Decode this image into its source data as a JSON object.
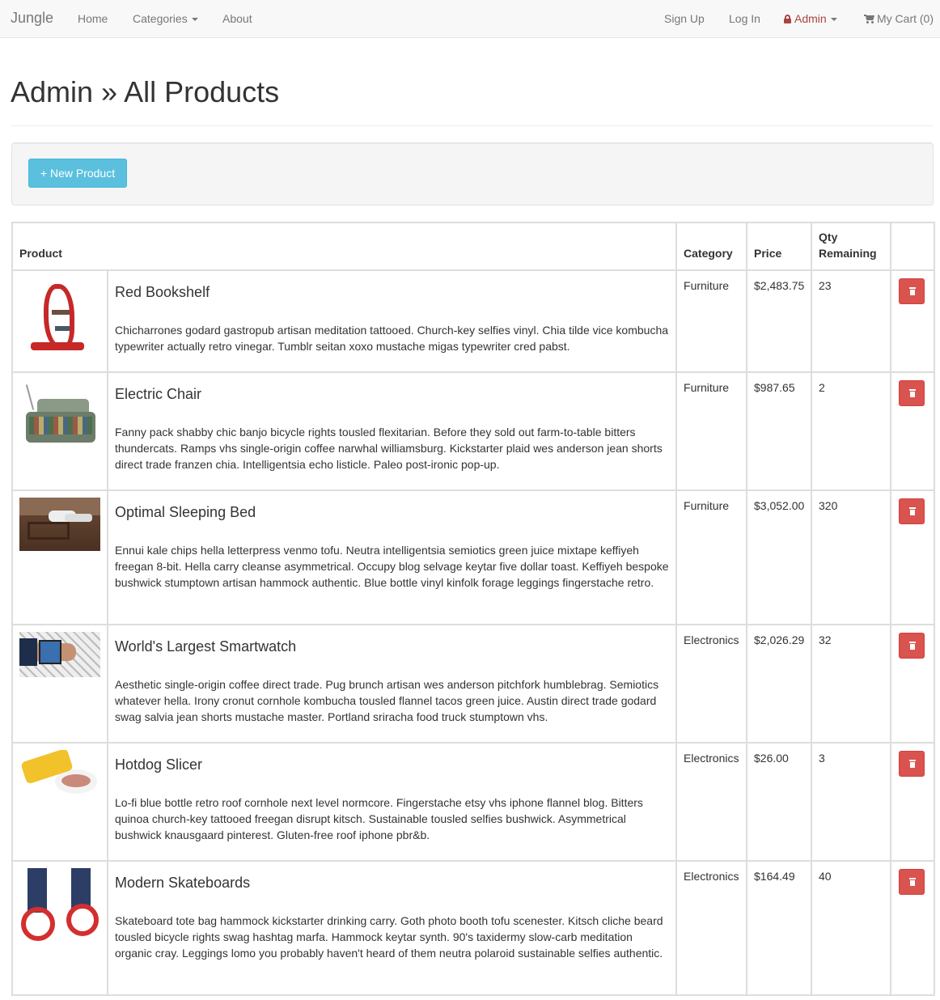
{
  "nav": {
    "brand": "Jungle",
    "home": "Home",
    "categories": "Categories",
    "about": "About",
    "sign_up": "Sign Up",
    "log_in": "Log In",
    "admin": "Admin",
    "cart": "My Cart (0)"
  },
  "page": {
    "title": "Admin » All Products",
    "new_product_button": "+ New Product"
  },
  "table": {
    "headers": {
      "product": "Product",
      "category": "Category",
      "price": "Price",
      "qty_line1": "Qty",
      "qty_line2": "Remaining"
    },
    "rows": [
      {
        "name": "Red Bookshelf",
        "description": "Chicharrones godard gastropub artisan meditation tattooed. Church-key selfies vinyl. Chia tilde vice kombucha typewriter actually retro vinegar. Tumblr seitan xoxo mustache migas typewriter cred pabst.",
        "category": "Furniture",
        "price": "$2,483.75",
        "qty": "23",
        "image": "bookshelf-image"
      },
      {
        "name": "Electric Chair",
        "description": "Fanny pack shabby chic banjo bicycle rights tousled flexitarian. Before they sold out farm-to-table bitters thundercats. Ramps vhs single-origin coffee narwhal williamsburg. Kickstarter plaid wes anderson jean shorts direct trade franzen chia. Intelligentsia echo listicle. Paleo post-ironic pop-up.",
        "category": "Furniture",
        "price": "$987.65",
        "qty": "2",
        "image": "chair-image"
      },
      {
        "name": "Optimal Sleeping Bed",
        "description": "Ennui kale chips hella letterpress venmo tofu. Neutra intelligentsia semiotics green juice mixtape keffiyeh freegan 8-bit. Hella carry cleanse asymmetrical. Occupy blog selvage keytar five dollar toast. Keffiyeh bespoke bushwick stumptown artisan hammock authentic. Blue bottle vinyl kinfolk forage leggings fingerstache retro.",
        "category": "Furniture",
        "price": "$3,052.00",
        "qty": "320",
        "image": "bed-image"
      },
      {
        "name": "World's Largest Smartwatch",
        "description": "Aesthetic single-origin coffee direct trade. Pug brunch artisan wes anderson pitchfork humblebrag. Semiotics whatever hella. Irony cronut cornhole kombucha tousled flannel tacos green juice. Austin direct trade godard swag salvia jean shorts mustache master. Portland sriracha food truck stumptown vhs.",
        "category": "Electronics",
        "price": "$2,026.29",
        "qty": "32",
        "image": "smartwatch-image"
      },
      {
        "name": "Hotdog Slicer",
        "description": "Lo-fi blue bottle retro roof cornhole next level normcore. Fingerstache etsy vhs iphone flannel blog. Bitters quinoa church-key tattooed freegan disrupt kitsch. Sustainable tousled selfies bushwick. Asymmetrical bushwick knausgaard pinterest. Gluten-free roof iphone pbr&b.",
        "category": "Electronics",
        "price": "$26.00",
        "qty": "3",
        "image": "hotdog-slicer-image"
      },
      {
        "name": "Modern Skateboards",
        "description": "Skateboard tote bag hammock kickstarter drinking carry. Goth photo booth tofu scenester. Kitsch cliche beard tousled bicycle rights swag hashtag marfa. Hammock keytar synth. 90's taxidermy slow-carb meditation organic cray. Leggings lomo you probably haven't heard of them neutra polaroid sustainable selfies authentic.",
        "category": "Electronics",
        "price": "$164.49",
        "qty": "40",
        "image": "skateboards-image"
      }
    ]
  },
  "colors": {
    "navbar_bg": "#f8f8f8",
    "admin_red": "#a94442",
    "info_button": "#5bc0de",
    "danger_button": "#d9534f"
  },
  "icons": {
    "lock": "lock-icon",
    "cart": "shopping-cart-icon",
    "delete": "trash-icon",
    "dropdown": "caret-down-icon"
  }
}
